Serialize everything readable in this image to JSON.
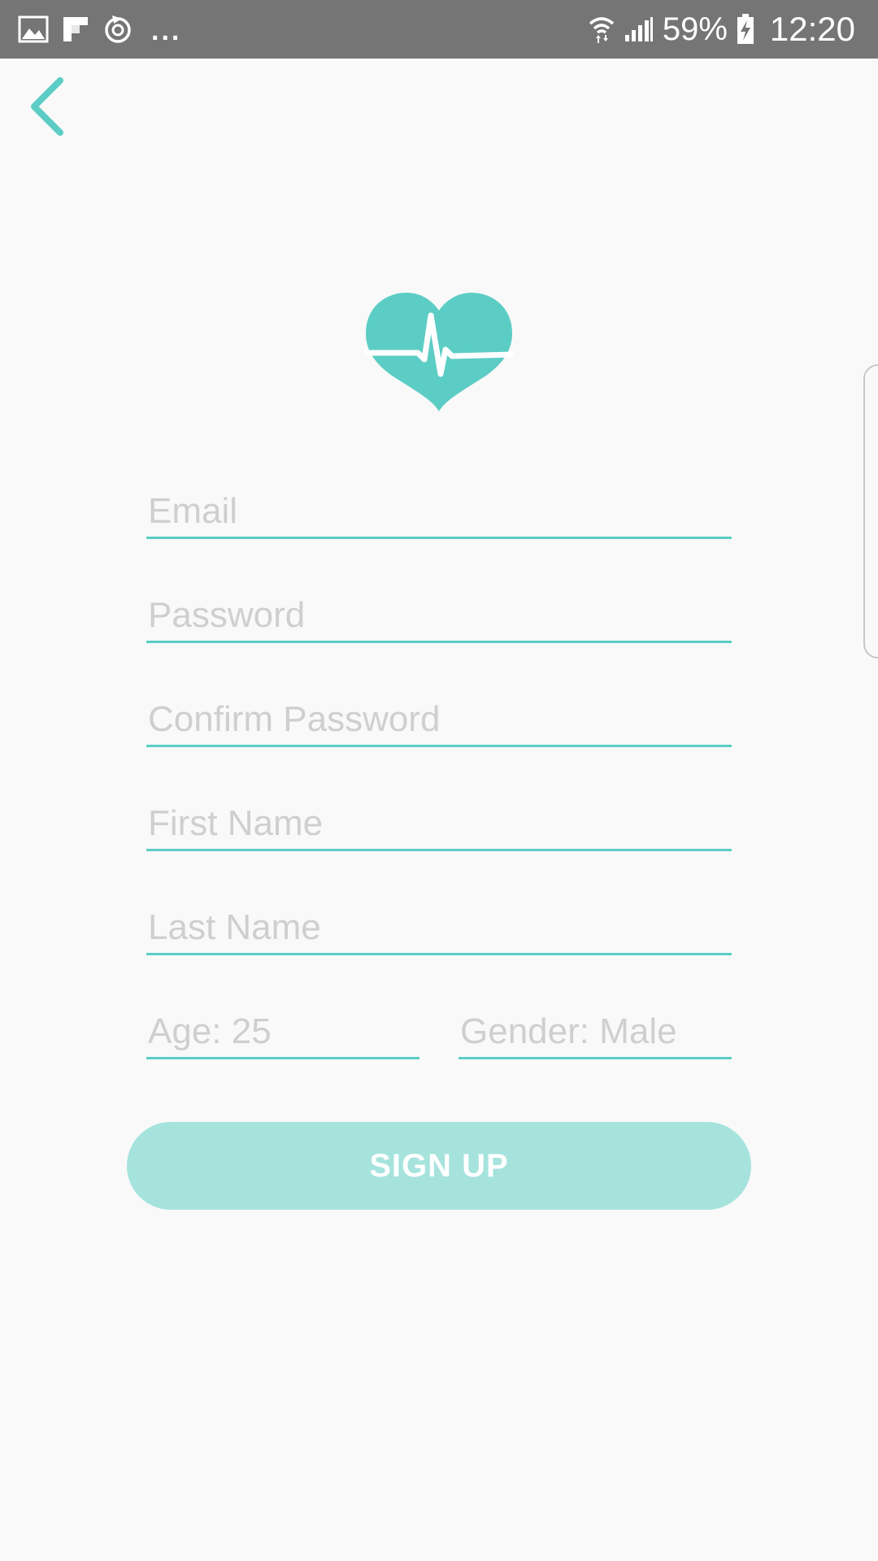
{
  "status_bar": {
    "battery_percent": "59%",
    "time": "12:20",
    "overflow_indicator": "...",
    "icons": [
      "gallery-icon",
      "flipboard-icon",
      "sync-icon",
      "wifi-icon",
      "signal-icon",
      "battery-charging-icon"
    ]
  },
  "nav": {
    "back_icon": "chevron-left-icon"
  },
  "logo": {
    "icon": "heart-pulse-icon"
  },
  "form": {
    "email": {
      "placeholder": "Email",
      "value": ""
    },
    "password": {
      "placeholder": "Password",
      "value": ""
    },
    "confirm_password": {
      "placeholder": "Confirm Password",
      "value": ""
    },
    "first_name": {
      "placeholder": "First Name",
      "value": ""
    },
    "last_name": {
      "placeholder": "Last Name",
      "value": ""
    },
    "age": {
      "placeholder": "Age: 25",
      "value": ""
    },
    "gender": {
      "placeholder": "Gender: Male",
      "value": ""
    }
  },
  "signup_label": "SIGN UP",
  "colors": {
    "accent": "#5ccdc4",
    "button": "#a6e3dd",
    "status_bar": "#757575",
    "background": "#f9f9f9",
    "placeholder": "#cfcfcf"
  }
}
